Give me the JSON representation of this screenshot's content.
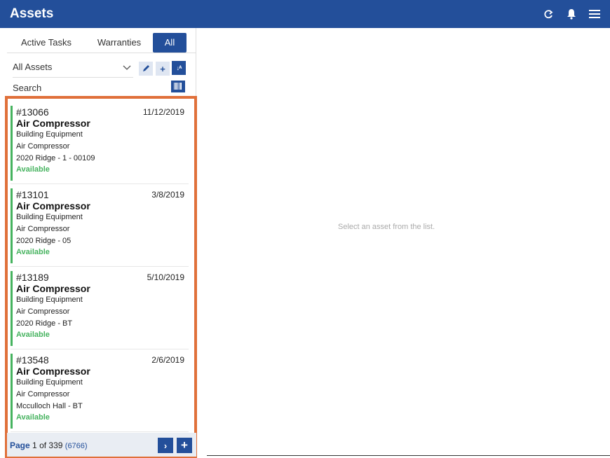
{
  "header": {
    "title": "Assets",
    "icons": [
      "refresh-icon",
      "bell-icon",
      "menu-icon"
    ]
  },
  "tabs": [
    "Active Tasks",
    "Warranties",
    "All"
  ],
  "filter": {
    "value": "All Assets"
  },
  "search": {
    "placeholder": "Search"
  },
  "assets": [
    {
      "number": "#13066",
      "date": "11/12/2019",
      "name": "Air Compressor",
      "category": "Building Equipment",
      "type": "Air Compressor",
      "location": "2020 Ridge - 1 - 00109",
      "status": "Available"
    },
    {
      "number": "#13101",
      "date": "3/8/2019",
      "name": "Air Compressor",
      "category": "Building Equipment",
      "type": "Air Compressor",
      "location": "2020 Ridge - 05",
      "status": "Available"
    },
    {
      "number": "#13189",
      "date": "5/10/2019",
      "name": "Air Compressor",
      "category": "Building Equipment",
      "type": "Air Compressor",
      "location": "2020 Ridge - BT",
      "status": "Available"
    },
    {
      "number": "#13548",
      "date": "2/6/2019",
      "name": "Air Compressor",
      "category": "Building Equipment",
      "type": "Air Compressor",
      "location": "Mcculloch Hall - BT",
      "status": "Available"
    }
  ],
  "pager": {
    "label": "Page",
    "current": "1",
    "of": "of 339",
    "total": "(6766)"
  },
  "detail": {
    "empty_message": "Select an asset from the list."
  },
  "colors": {
    "primary": "#234f9a",
    "status_available": "#46b35f",
    "highlight": "#e0703a"
  }
}
